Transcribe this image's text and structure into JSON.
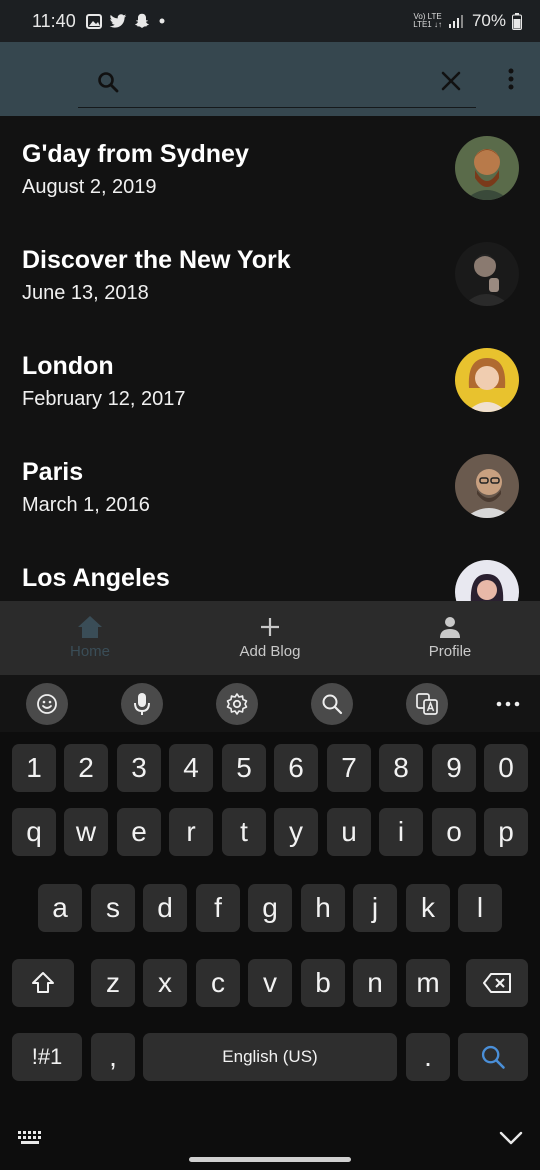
{
  "status_bar": {
    "time": "11:40",
    "battery": "70%",
    "network_top": "Vo) LTE",
    "network_bottom": "LTE1 ↓↑",
    "icons": [
      "gallery-icon",
      "twitter-icon",
      "snapchat-icon",
      "dot-icon",
      "signal-icon",
      "battery-icon"
    ]
  },
  "search": {
    "value": "",
    "placeholder": "",
    "icons": [
      "search-icon",
      "close-icon",
      "more-vert-icon"
    ]
  },
  "posts": [
    {
      "title": "G'day from Sydney",
      "date": "August 2, 2019",
      "avatar_bg": "#5a6b4a",
      "avatar_fg": "#b87a4a"
    },
    {
      "title": "Discover the New York",
      "date": "June 13, 2018",
      "avatar_bg": "#1a1a1a",
      "avatar_fg": "#8a7a70"
    },
    {
      "title": "London",
      "date": "February 12, 2017",
      "avatar_bg": "#e8c22e",
      "avatar_fg": "#f0cdb0"
    },
    {
      "title": "Paris",
      "date": "March 1, 2016",
      "avatar_bg": "#6a5a4e",
      "avatar_fg": "#c8a080"
    },
    {
      "title": "Los Angeles",
      "date": "",
      "avatar_bg": "#e8e8f0",
      "avatar_fg": "#2a2030"
    }
  ],
  "bottom_nav": {
    "items": [
      {
        "label": "Home",
        "icon": "home-icon",
        "active": true
      },
      {
        "label": "Add Blog",
        "icon": "plus-icon",
        "active": false
      },
      {
        "label": "Profile",
        "icon": "person-icon",
        "active": false
      }
    ]
  },
  "keyboard": {
    "toolbar": [
      "emoji-icon",
      "mic-icon",
      "settings-icon",
      "search-icon",
      "translate-icon",
      "more-horiz-icon"
    ],
    "row_numbers": [
      "1",
      "2",
      "3",
      "4",
      "5",
      "6",
      "7",
      "8",
      "9",
      "0"
    ],
    "row_q": [
      "q",
      "w",
      "e",
      "r",
      "t",
      "y",
      "u",
      "i",
      "o",
      "p"
    ],
    "row_a": [
      "a",
      "s",
      "d",
      "f",
      "g",
      "h",
      "j",
      "k",
      "l"
    ],
    "row_z": [
      "z",
      "x",
      "c",
      "v",
      "b",
      "n",
      "m"
    ],
    "symbols_label": "!#1",
    "comma": ",",
    "space_label": "English (US)",
    "period": ".",
    "accent_color": "#4a8fd8"
  }
}
